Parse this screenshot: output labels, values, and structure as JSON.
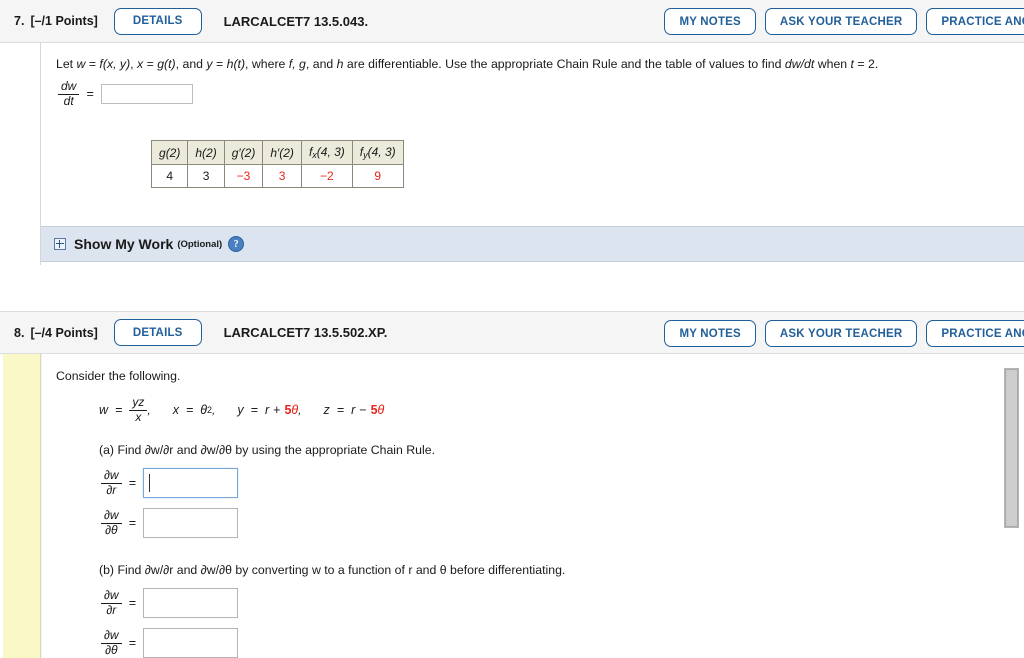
{
  "questions": [
    {
      "number": "7.",
      "points": "[–/1 Points]",
      "details_label": "DETAILS",
      "title": "LARCALCET7 13.5.043.",
      "actions": [
        {
          "label": "MY NOTES",
          "name": "my-notes-button"
        },
        {
          "label": "ASK YOUR TEACHER",
          "name": "ask-your-teacher-button"
        },
        {
          "label": "PRACTICE ANOTHER",
          "name": "practice-another-button"
        }
      ],
      "prompt_parts": {
        "p1": "Let ",
        "w": "w",
        "eq1": " = ",
        "f": "f",
        "xy": "(x, y)",
        "comma1": ", ",
        "x": "x",
        "eq2": " = ",
        "g": "g",
        "t1": "(t)",
        "comma2": ", and ",
        "y": "y",
        "eq3": " = ",
        "h": "h",
        "t2": "(t)",
        "comma3": ",  where ",
        "fgh": "f, g",
        "andh": ", and ",
        "h2": "h",
        "tail": " are differentiable. Use the appropriate Chain Rule and the table of values to find ",
        "dwdt": "dw/dt",
        "when": " when ",
        "tvar": "t",
        "teq": " = 2."
      },
      "answer_fraction": {
        "num": "dw",
        "den": "dt"
      },
      "equals": "=",
      "table": {
        "headers": [
          {
            "main": "g",
            "paren": "(2)",
            "sub": "",
            "kind": "plain"
          },
          {
            "main": "h",
            "paren": "(2)",
            "sub": "",
            "kind": "plain"
          },
          {
            "main": "g′",
            "paren": "(2)",
            "sub": "",
            "kind": "plain"
          },
          {
            "main": "h′",
            "paren": "(2)",
            "sub": "",
            "kind": "plain"
          },
          {
            "main": "f",
            "paren": "(4, 3)",
            "sub": "x",
            "kind": "sub"
          },
          {
            "main": "f",
            "paren": "(4, 3)",
            "sub": "y",
            "kind": "sub"
          }
        ],
        "values": [
          "4",
          "3",
          "−3",
          "3",
          "−2",
          "9"
        ],
        "value_colors": [
          "#1a1a1a",
          "#1a1a1a",
          "#e8241a",
          "#e8241a",
          "#e8241a",
          "#e8241a"
        ]
      },
      "show_my_work": {
        "title": "Show My Work",
        "optional": "(Optional)",
        "help": "?"
      }
    },
    {
      "number": "8.",
      "points": "[–/4 Points]",
      "details_label": "DETAILS",
      "title": "LARCALCET7 13.5.502.XP.",
      "actions": [
        {
          "label": "MY NOTES",
          "name": "my-notes-button"
        },
        {
          "label": "ASK YOUR TEACHER",
          "name": "ask-your-teacher-button"
        },
        {
          "label": "PRACTICE ANOTHER",
          "name": "practice-another-button"
        }
      ],
      "consider": "Consider the following.",
      "equation": {
        "w": "w",
        "eq": "=",
        "frac_num": "yz",
        "frac_den": "x",
        "comma1": ",",
        "x": "x",
        "eq2": "=",
        "theta_sq_base": "θ",
        "theta_sq_exp": "2",
        "comma2": ",",
        "y": "y",
        "eq3": "=",
        "y_rhs_r": "r",
        "y_rhs_op": "+",
        "y_rhs_coef": "5",
        "y_rhs_theta": "θ",
        "comma3": ",",
        "z": "z",
        "eq4": "=",
        "z_rhs_r": "r",
        "z_rhs_op": "−",
        "z_rhs_coef": "5",
        "z_rhs_theta": "θ"
      },
      "part_a": {
        "text": "(a) Find ∂w/∂r and ∂w/∂θ by using the appropriate Chain Rule.",
        "rows": [
          {
            "num": "∂w",
            "den": "∂r",
            "equals": "=",
            "focused": true
          },
          {
            "num": "∂w",
            "den": "∂θ",
            "equals": "=",
            "focused": false
          }
        ]
      },
      "part_b": {
        "text": "(b) Find ∂w/∂r and ∂w/∂θ by converting w to a function of r and θ before differentiating.",
        "rows": [
          {
            "num": "∂w",
            "den": "∂r",
            "equals": "=",
            "focused": false
          },
          {
            "num": "∂w",
            "den": "∂θ",
            "equals": "=",
            "focused": false
          }
        ]
      }
    }
  ],
  "colors": {
    "accent_blue": "#215f9a",
    "red_value": "#e8241a",
    "header_bg": "#f5f5f5",
    "show_work_bg": "#dbe4ef",
    "left_stripe": "#fbf8c8"
  }
}
